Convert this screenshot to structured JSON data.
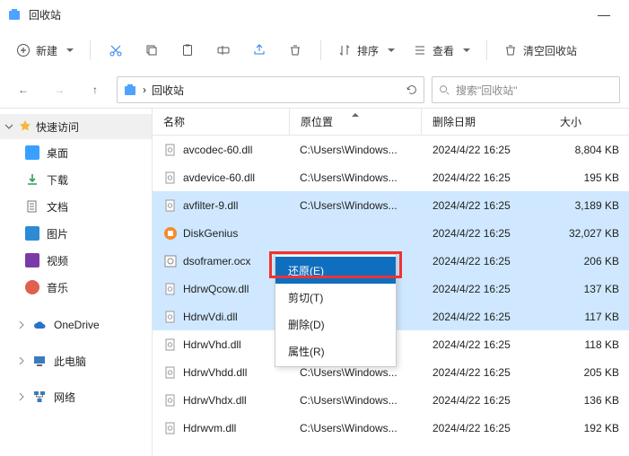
{
  "window": {
    "title": "回收站"
  },
  "toolbar": {
    "new_label": "新建",
    "sort_label": "排序",
    "view_label": "查看",
    "empty_label": "清空回收站"
  },
  "address": {
    "location": "回收站",
    "sep": "›"
  },
  "search": {
    "placeholder": "搜索\"回收站\""
  },
  "sidebar": {
    "quick": "快速访问",
    "items": [
      {
        "label": "桌面"
      },
      {
        "label": "下载"
      },
      {
        "label": "文档"
      },
      {
        "label": "图片"
      },
      {
        "label": "视频"
      },
      {
        "label": "音乐"
      }
    ],
    "onedrive": "OneDrive",
    "thispc": "此电脑",
    "network": "网络"
  },
  "columns": {
    "name": "名称",
    "location": "原位置",
    "date": "删除日期",
    "size": "大小"
  },
  "files": [
    {
      "name": "avcodec-60.dll",
      "loc": "C:\\Users\\Windows...",
      "date": "2024/4/22 16:25",
      "size": "8,804 KB",
      "sel": false,
      "type": "dll"
    },
    {
      "name": "avdevice-60.dll",
      "loc": "C:\\Users\\Windows...",
      "date": "2024/4/22 16:25",
      "size": "195 KB",
      "sel": false,
      "type": "dll"
    },
    {
      "name": "avfilter-9.dll",
      "loc": "C:\\Users\\Windows...",
      "date": "2024/4/22 16:25",
      "size": "3,189 KB",
      "sel": true,
      "type": "dll"
    },
    {
      "name": "DiskGenius",
      "loc": "",
      "date": "2024/4/22 16:25",
      "size": "32,027 KB",
      "sel": true,
      "type": "exe"
    },
    {
      "name": "dsoframer.ocx",
      "loc": "...",
      "date": "2024/4/22 16:25",
      "size": "206 KB",
      "sel": true,
      "type": "gear"
    },
    {
      "name": "HdrwQcow.dll",
      "loc": "",
      "date": "2024/4/22 16:25",
      "size": "137 KB",
      "sel": true,
      "type": "dll"
    },
    {
      "name": "HdrwVdi.dll",
      "loc": "",
      "date": "2024/4/22 16:25",
      "size": "117 KB",
      "sel": true,
      "type": "dll"
    },
    {
      "name": "HdrwVhd.dll",
      "loc": "C:\\Users\\Windows...",
      "date": "2024/4/22 16:25",
      "size": "118 KB",
      "sel": false,
      "type": "dll"
    },
    {
      "name": "HdrwVhdd.dll",
      "loc": "C:\\Users\\Windows...",
      "date": "2024/4/22 16:25",
      "size": "205 KB",
      "sel": false,
      "type": "dll"
    },
    {
      "name": "HdrwVhdx.dll",
      "loc": "C:\\Users\\Windows...",
      "date": "2024/4/22 16:25",
      "size": "136 KB",
      "sel": false,
      "type": "dll"
    },
    {
      "name": "Hdrwvm.dll",
      "loc": "C:\\Users\\Windows...",
      "date": "2024/4/22 16:25",
      "size": "192 KB",
      "sel": false,
      "type": "dll"
    }
  ],
  "context_menu": {
    "restore": "还原(E)",
    "cut": "剪切(T)",
    "delete": "删除(D)",
    "properties": "属性(R)"
  }
}
